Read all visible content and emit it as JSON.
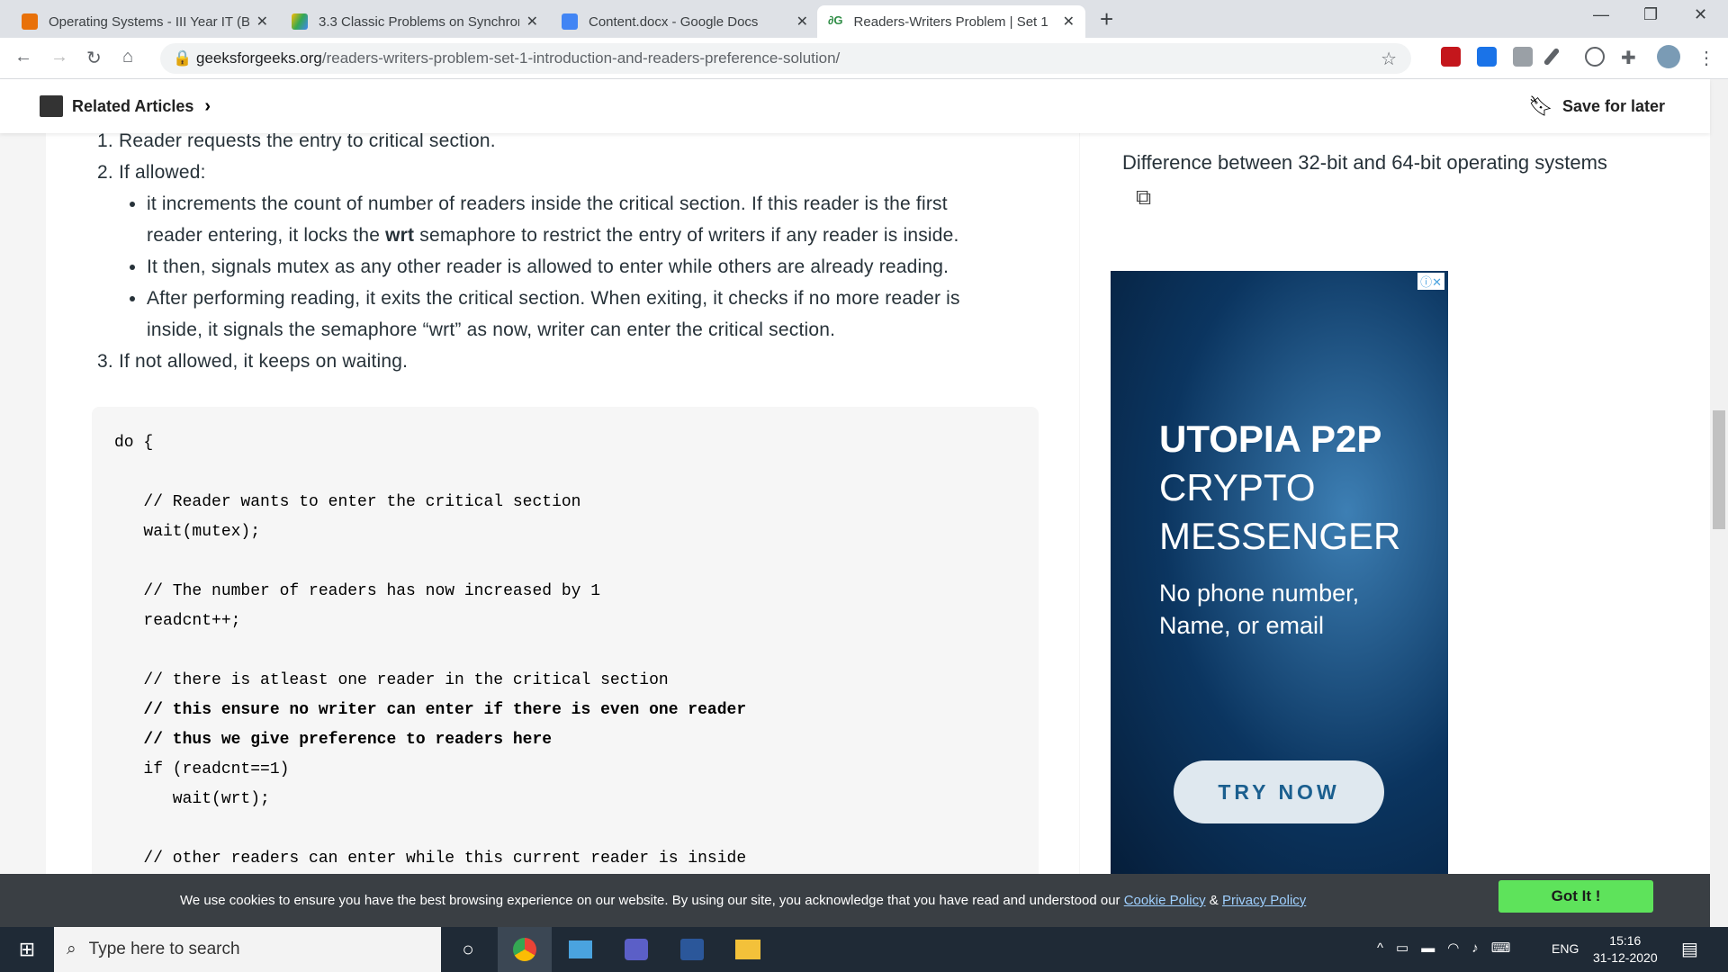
{
  "browser": {
    "tabs": [
      {
        "title": "Operating Systems - III Year IT (B",
        "color": "#e8710a"
      },
      {
        "title": "3.3 Classic Problems on Synchron",
        "color": "#fbbc04"
      },
      {
        "title": "Content.docx - Google Docs",
        "color": "#4285f4"
      },
      {
        "title": "Readers-Writers Problem | Set 1",
        "color": "#2f8d46"
      }
    ],
    "url_domain": "geeksforgeeks.org",
    "url_path": "/readers-writers-problem-set-1-introduction-and-readers-preference-solution/"
  },
  "header": {
    "related": "Related Articles",
    "save": "Save for later"
  },
  "article": {
    "step1": "1. Reader requests the entry to critical section.",
    "step2": "2. If allowed:",
    "b1a": "it increments the count of number of readers inside the critical section. If this reader is the first",
    "b1b_pre": "reader entering, it locks the ",
    "b1b_bold": "wrt",
    "b1b_post": " semaphore to restrict the entry of writers if any reader is inside.",
    "b2": "It then, signals mutex as any other reader is allowed to enter while others are already reading.",
    "b3a": "After performing reading, it exits the critical section. When exiting, it checks if no more reader is",
    "b3b": "inside, it signals the semaphore “wrt” as now, writer can enter the critical section.",
    "step3": "3. If not allowed, it keeps on waiting.",
    "code": [
      "do {",
      "",
      "   // Reader wants to enter the critical section",
      "   wait(mutex);",
      "",
      "   // The number of readers has now increased by 1",
      "   readcnt++;",
      "",
      "   // there is atleast one reader in the critical section",
      "   // this ensure no writer can enter if there is even one reader",
      "   // thus we give preference to readers here",
      "   if (readcnt==1)",
      "      wait(wrt);",
      "",
      "   // other readers can enter while this current reader is inside"
    ]
  },
  "sidebar": {
    "link": "Difference between 32-bit and 64-bit operating systems"
  },
  "ad": {
    "title1": "UTOPIA P2P",
    "title2": "CRYPTO",
    "title3": "MESSENGER",
    "sub1": "No phone number,",
    "sub2": "Name, or email",
    "cta": "TRY NOW"
  },
  "cookie": {
    "text": "We use cookies to ensure you have the best browsing experience on our website. By using our site, you acknowledge that you have read and understood our ",
    "policy": "Cookie Policy",
    "amp": " & ",
    "privacy": "Privacy Policy",
    "button": "Got It !"
  },
  "taskbar": {
    "search": "Type here to search",
    "lang": "ENG",
    "time": "15:16",
    "date": "31-12-2020"
  }
}
